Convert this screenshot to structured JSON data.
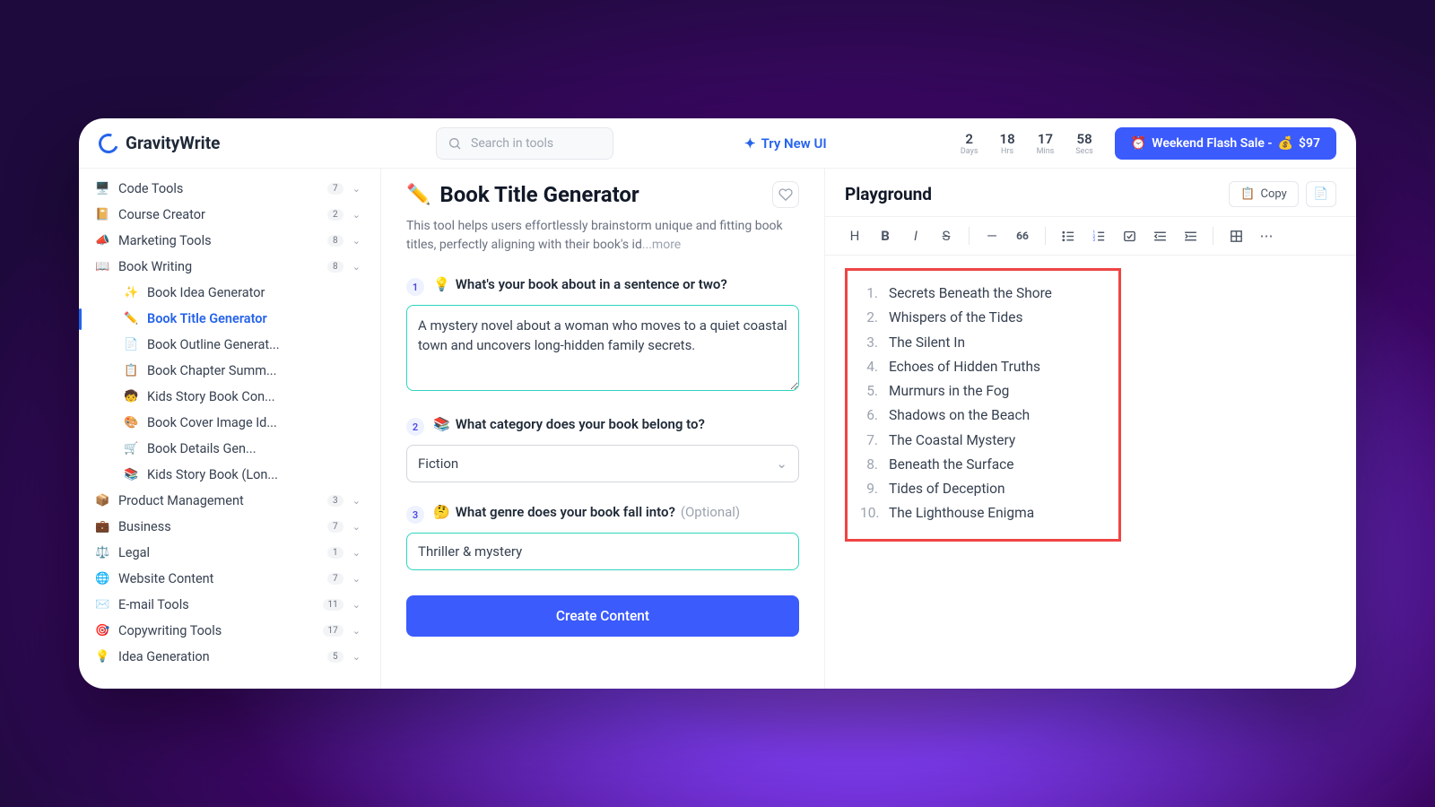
{
  "brand": "GravityWrite",
  "search_placeholder": "Search in tools",
  "try_new": "Try New UI",
  "countdown": [
    {
      "num": "2",
      "lbl": "Days"
    },
    {
      "num": "18",
      "lbl": "Hrs"
    },
    {
      "num": "17",
      "lbl": "Mins"
    },
    {
      "num": "58",
      "lbl": "Secs"
    }
  ],
  "flash": {
    "text": "Weekend Flash Sale -",
    "price": "$97"
  },
  "sidebar": {
    "groups": [
      {
        "icon": "🖥️",
        "label": "Code Tools",
        "badge": "7"
      },
      {
        "icon": "📔",
        "label": "Course Creator",
        "badge": "2"
      },
      {
        "icon": "📣",
        "label": "Marketing Tools",
        "badge": "8"
      },
      {
        "icon": "📖",
        "label": "Book Writing",
        "badge": "8"
      }
    ],
    "sub": [
      {
        "icon": "✨",
        "label": "Book Idea Generator"
      },
      {
        "icon": "✏️",
        "label": "Book Title Generator",
        "active": true
      },
      {
        "icon": "📄",
        "label": "Book Outline Generat..."
      },
      {
        "icon": "📋",
        "label": "Book Chapter Summ..."
      },
      {
        "icon": "🧒",
        "label": "Kids Story Book Con..."
      },
      {
        "icon": "🎨",
        "label": "Book Cover Image Id..."
      },
      {
        "icon": "🛒",
        "label": "Book Details Gen..."
      },
      {
        "icon": "📚",
        "label": "Kids Story Book (Lon..."
      }
    ],
    "groups2": [
      {
        "icon": "📦",
        "label": "Product Management",
        "badge": "3"
      },
      {
        "icon": "💼",
        "label": "Business",
        "badge": "7"
      },
      {
        "icon": "⚖️",
        "label": "Legal",
        "badge": "1"
      },
      {
        "icon": "🌐",
        "label": "Website Content",
        "badge": "7"
      },
      {
        "icon": "✉️",
        "label": "E-mail Tools",
        "badge": "11"
      },
      {
        "icon": "🎯",
        "label": "Copywriting Tools",
        "badge": "17"
      },
      {
        "icon": "💡",
        "label": "Idea Generation",
        "badge": "5"
      }
    ]
  },
  "tool": {
    "icon": "✏️",
    "title": "Book Title Generator",
    "desc": "This tool helps users effortlessly brainstorm unique and fitting book titles, perfectly aligning with their book's id",
    "more": "...more",
    "q1": {
      "num": "1",
      "icon": "💡",
      "label": "What's your book about in a sentence or two?",
      "value": "A mystery novel about a woman who moves to a quiet coastal town and uncovers long-hidden family secrets."
    },
    "q2": {
      "num": "2",
      "icon": "📚",
      "label": "What category does your book belong to?",
      "value": "Fiction"
    },
    "q3": {
      "num": "3",
      "icon": "🤔",
      "label": "What genre does your book fall into?",
      "opt": "(Optional)",
      "value": "Thriller & mystery"
    },
    "cta": "Create Content"
  },
  "play": {
    "title": "Playground",
    "copy": "Copy",
    "results": [
      "Secrets Beneath the Shore",
      "Whispers of the Tides",
      "The Silent In",
      "Echoes of Hidden Truths",
      "Murmurs in the Fog",
      "Shadows on the Beach",
      "The Coastal Mystery",
      "Beneath the Surface",
      "Tides of Deception",
      "The Lighthouse Enigma"
    ]
  }
}
